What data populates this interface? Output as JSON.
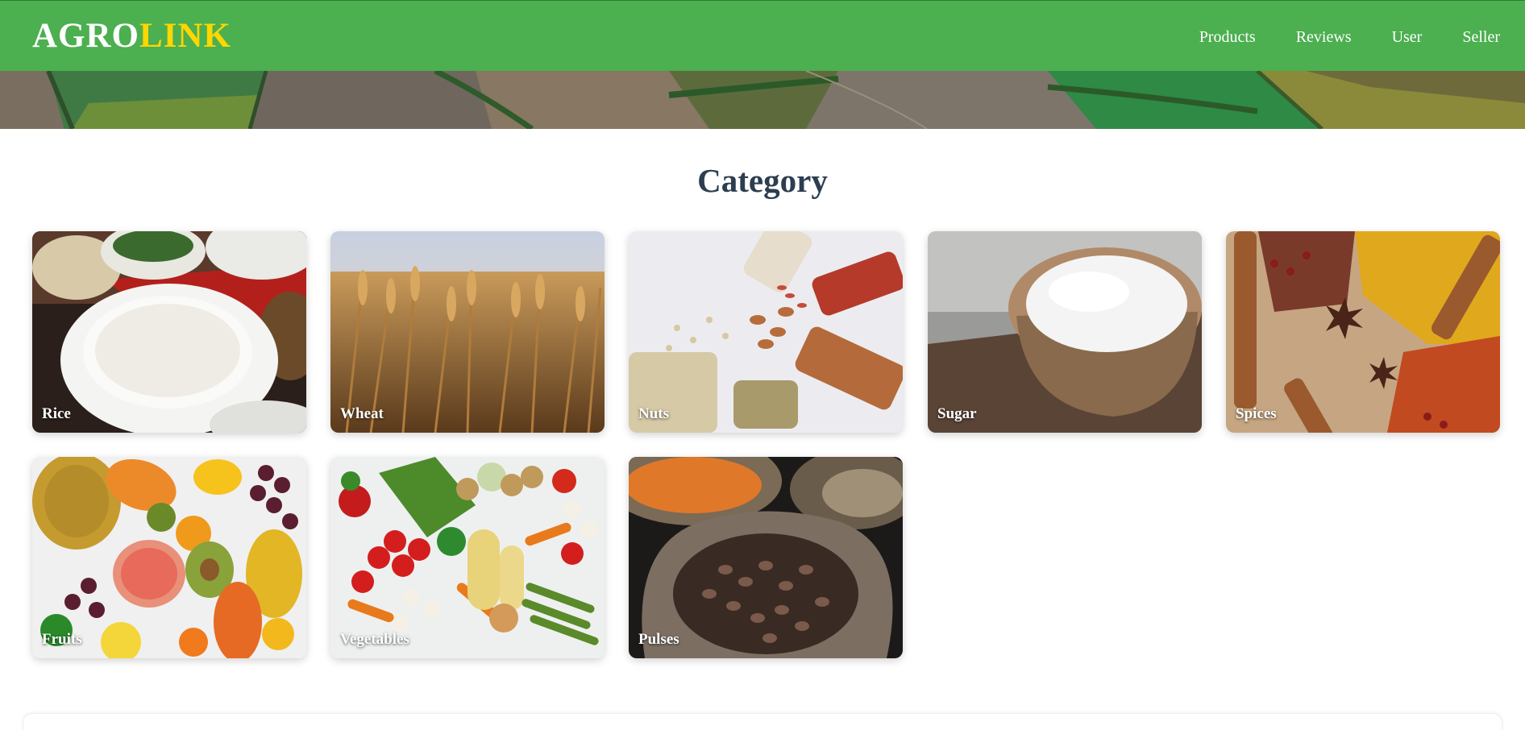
{
  "brand": {
    "part1": "AGRO",
    "part2": "LINK",
    "color_primary": "#4caf50",
    "color_accent": "#ffd700"
  },
  "nav": {
    "items": [
      "Products",
      "Reviews",
      "User",
      "Seller"
    ]
  },
  "section": {
    "title": "Category"
  },
  "categories": [
    {
      "label": "Rice"
    },
    {
      "label": "Wheat"
    },
    {
      "label": "Nuts"
    },
    {
      "label": "Sugar"
    },
    {
      "label": "Spices"
    },
    {
      "label": "Fruits"
    },
    {
      "label": "Vegetables"
    },
    {
      "label": "Pulses"
    }
  ]
}
